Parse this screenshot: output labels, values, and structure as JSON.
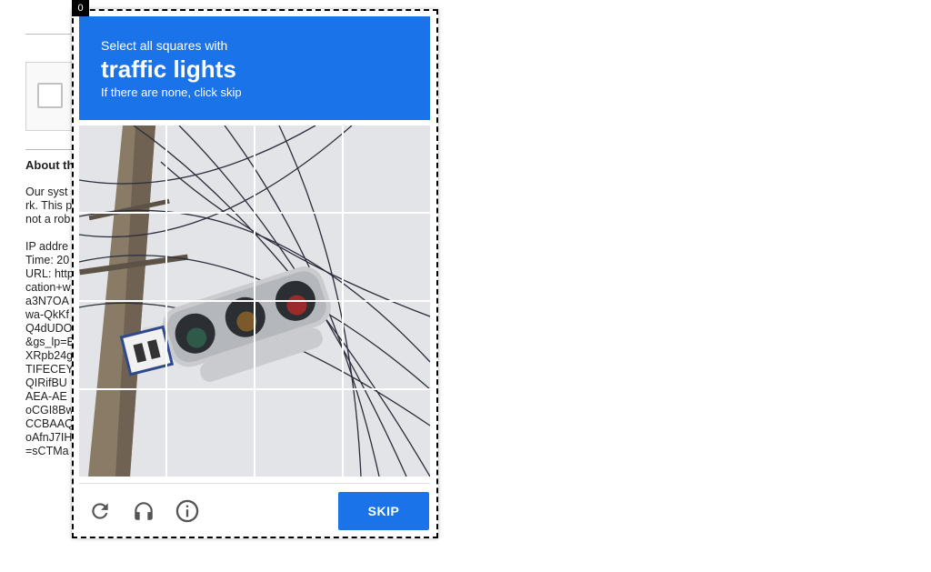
{
  "background_page": {
    "heading": "About th",
    "paragraph_lines": [
      "Our syst",
      "rk. This p",
      "not a rob"
    ],
    "detail_lines": [
      "IP addre",
      "Time: 20",
      "URL: http",
      "cation+w",
      "a3N7OA",
      "wa-QkKf",
      "Q4dUDO",
      "&gs_lp=E",
      "XRpb24g",
      "TIFECEY",
      "QIRifBU",
      "AEA-AE",
      "oCGI8Bw",
      "CCBAAQ",
      "oAfnJ7IH",
      "=sCTMa"
    ]
  },
  "captcha": {
    "frame_index": "0",
    "instruction": "Select all squares with",
    "target": "traffic lights",
    "hint": "If there are none, click skip",
    "grid_rows": 4,
    "grid_cols": 4,
    "reload_icon": "reload-icon",
    "audio_icon": "headphones-icon",
    "info_icon": "info-icon",
    "skip_label": "SKIP",
    "accent_color": "#1a73e8"
  }
}
